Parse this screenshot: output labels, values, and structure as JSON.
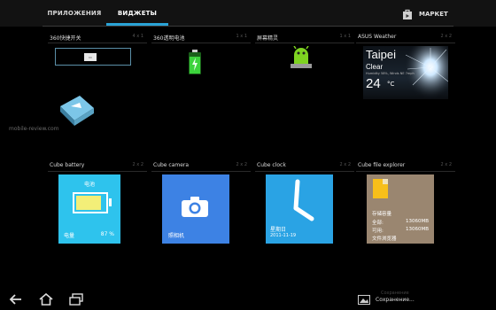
{
  "tabs": {
    "apps": "ПРИЛОЖЕНИЯ",
    "widgets": "ВИДЖЕТЫ",
    "market": "МАРКЕТ"
  },
  "colors": {
    "accent": "#2aa3d6",
    "battery_bg": "#2ec3ed",
    "camera_bg": "#3d82e4",
    "clock_bg": "#2aa3e4",
    "explorer_bg": "#9a8670"
  },
  "widgets": [
    {
      "title": "360快捷开关",
      "size": "4 x 1"
    },
    {
      "title": "360透明电池",
      "size": "1 x 1"
    },
    {
      "title": "屏幕精灵",
      "size": "1 x 1"
    },
    {
      "title": "ASUS Weather",
      "size": "2 x 2"
    },
    {
      "title": "Cube battery",
      "size": "2 x 2"
    },
    {
      "title": "Cube camera",
      "size": "2 x 2"
    },
    {
      "title": "Cube clock",
      "size": "2 x 2"
    },
    {
      "title": "Cube file explorer",
      "size": "2 x 2"
    }
  ],
  "watermark": "mobile-review.com",
  "weather": {
    "city": "Taipei",
    "condition": "Clear",
    "detail": "Humidity 58%, Winds NE 7mph",
    "temp": "24",
    "unit": "°C"
  },
  "battery": {
    "title": "电池",
    "label": "电量",
    "percent": "87 %",
    "level": 0.87
  },
  "camera": {
    "label": "照相机"
  },
  "clock": {
    "day": "星期日",
    "date": "2011-11-19"
  },
  "explorer": {
    "title": "存储容量",
    "all_label": "全部:",
    "all_value": "13060MB",
    "free_label": "可用:",
    "free_value": "13060MB",
    "browse": "文件浏览器"
  },
  "status": {
    "saving": "Сохранение...",
    "ghost": "Сохранение"
  },
  "icons": {
    "back": "back-arrow-icon",
    "home": "home-icon",
    "recent": "recent-apps-icon",
    "market": "market-bag-icon",
    "picture": "picture-icon"
  }
}
